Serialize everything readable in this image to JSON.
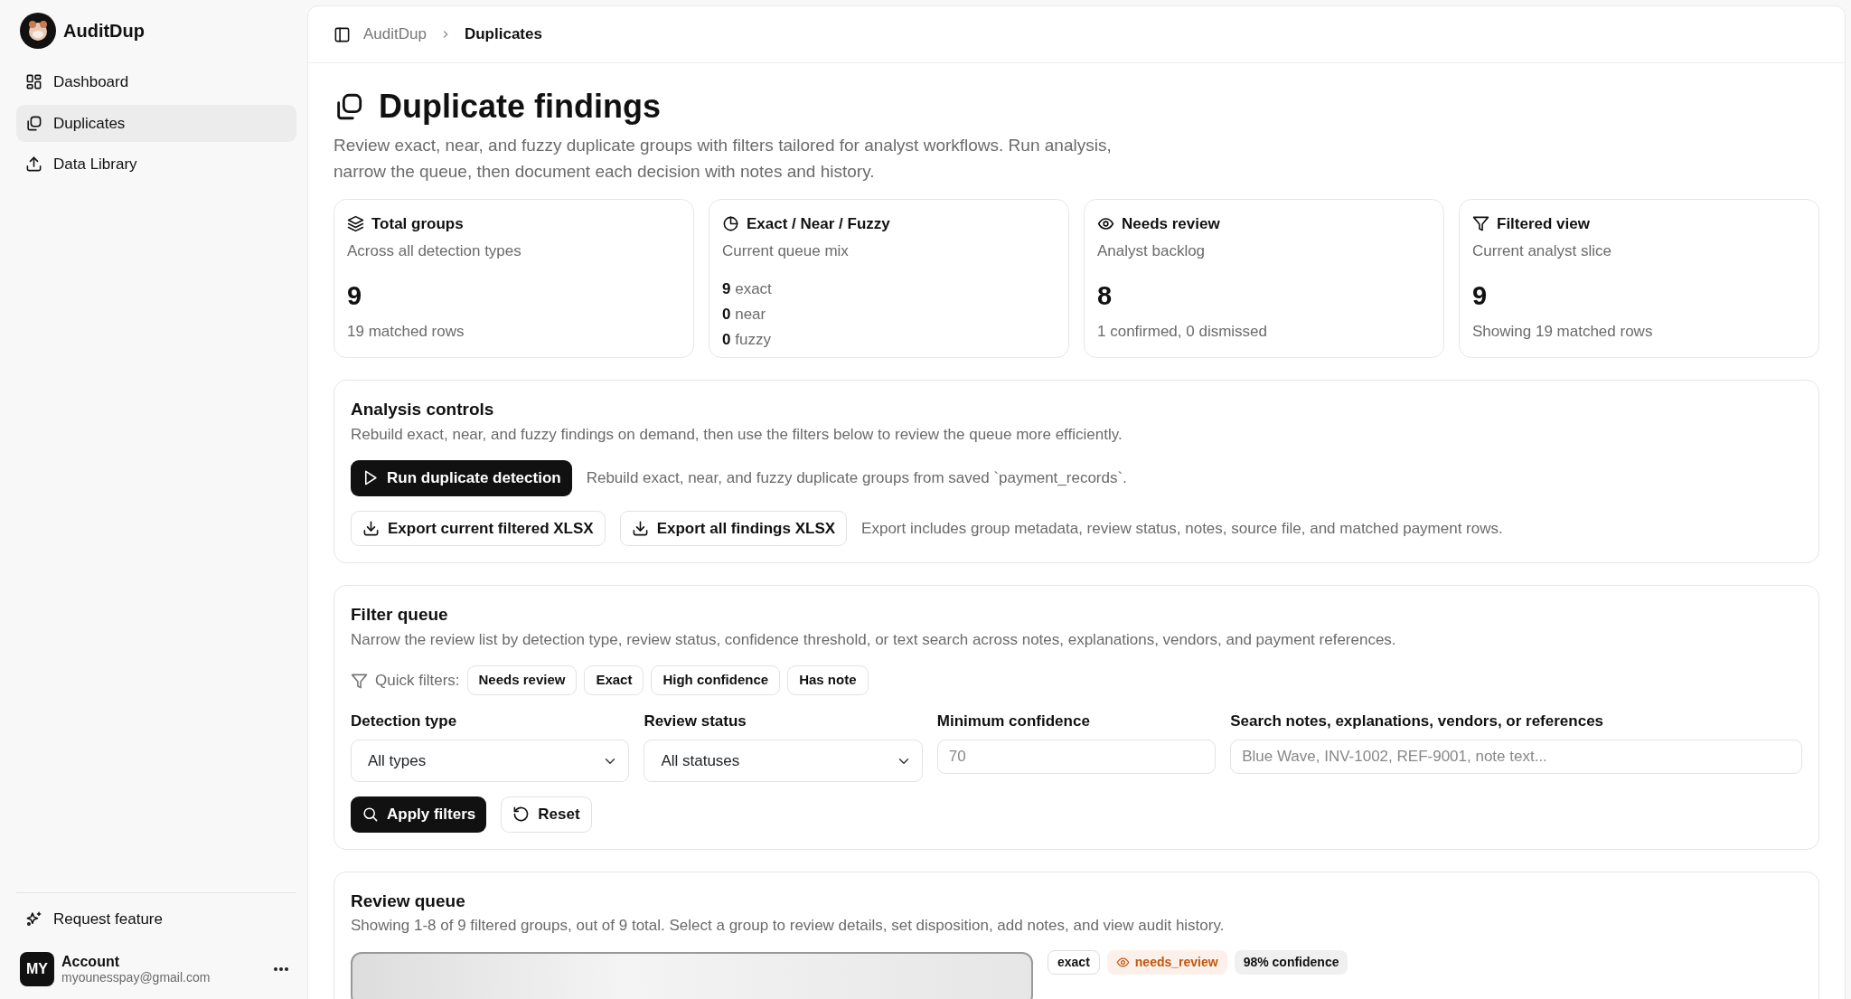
{
  "app": {
    "name": "AuditDup"
  },
  "sidebar": {
    "items": [
      {
        "label": "Dashboard",
        "selected": false
      },
      {
        "label": "Duplicates",
        "selected": true
      },
      {
        "label": "Data Library",
        "selected": false
      }
    ],
    "request_feature": "Request feature",
    "account": {
      "initials": "MY",
      "name": "Account",
      "email": "myounesspay@gmail.com"
    }
  },
  "breadcrumb": [
    "AuditDup",
    "Duplicates"
  ],
  "page": {
    "title": "Duplicate findings",
    "description": "Review exact, near, and fuzzy duplicate groups with filters tailored for analyst workflows. Run analysis, narrow the queue, then document each decision with notes and history."
  },
  "stats": [
    {
      "kind": "stat",
      "title": "Total groups",
      "subtitle": "Across all detection types",
      "value": "9",
      "note": "19 matched rows"
    },
    {
      "kind": "mix",
      "title": "Exact / Near / Fuzzy",
      "subtitle": "Current queue mix",
      "mix": [
        {
          "count": "9",
          "label": "exact"
        },
        {
          "count": "0",
          "label": "near"
        },
        {
          "count": "0",
          "label": "fuzzy"
        }
      ]
    },
    {
      "kind": "stat",
      "title": "Needs review",
      "subtitle": "Analyst backlog",
      "value": "8",
      "note": "1 confirmed, 0 dismissed"
    },
    {
      "kind": "stat",
      "title": "Filtered view",
      "subtitle": "Current analyst slice",
      "value": "9",
      "note": "Showing 19 matched rows"
    }
  ],
  "analysis": {
    "title": "Analysis controls",
    "description": "Rebuild exact, near, and fuzzy findings on demand, then use the filters below to review the queue more efficiently.",
    "run_button": "Run duplicate detection",
    "run_note": "Rebuild exact, near, and fuzzy duplicate groups from saved `payment_records`.",
    "export_buttons": [
      "Export current filtered XLSX",
      "Export all findings XLSX"
    ],
    "export_note": "Export includes group metadata, review status, notes, source file, and matched payment rows."
  },
  "filters": {
    "title": "Filter queue",
    "description": "Narrow the review list by detection type, review status, confidence threshold, or text search across notes, explanations, vendors, and payment references.",
    "quick_label": "Quick filters:",
    "quick": [
      "Needs review",
      "Exact",
      "High confidence",
      "Has note"
    ],
    "fields": [
      {
        "kind": "select",
        "label": "Detection type",
        "value": "All types"
      },
      {
        "kind": "select",
        "label": "Review status",
        "value": "All statuses"
      },
      {
        "kind": "input",
        "label": "Minimum confidence",
        "placeholder": "70"
      },
      {
        "kind": "input",
        "label": "Search notes, explanations, vendors, or references",
        "placeholder": "Blue Wave, INV-1002, REF-9001, note text..."
      }
    ],
    "apply_button": "Apply filters",
    "reset_button": "Reset"
  },
  "review": {
    "title": "Review queue",
    "description": "Showing 1-8 of 9 filtered groups, out of 9 total. Select a group to review details, set disposition, add notes, and view audit history.",
    "tags": [
      {
        "kind": "type",
        "text": "exact"
      },
      {
        "kind": "status",
        "text": "needs_review"
      },
      {
        "kind": "confidence",
        "text": "98% confidence"
      }
    ]
  }
}
